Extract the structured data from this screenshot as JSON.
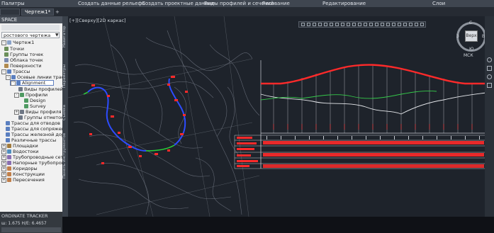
{
  "ribbon": {
    "items": [
      {
        "label": "Палитры"
      },
      {
        "label": "Создать данные рельефа"
      },
      {
        "label": "Создать проектные данные"
      },
      {
        "label": "Виды профилей и сечений"
      },
      {
        "label": "Рисование"
      },
      {
        "label": "Редактирование"
      },
      {
        "label": "Слои"
      }
    ]
  },
  "tabs": [
    {
      "label": "Чертеж1*"
    }
  ],
  "palette": {
    "title": "SPACE",
    "drop_value": "ростового чертежа",
    "tree": [
      {
        "label": "Чертеж1",
        "level": 0
      },
      {
        "label": "Точки",
        "level": 1
      },
      {
        "label": "Группы точек",
        "level": 1
      },
      {
        "label": "Облака точек",
        "level": 1
      },
      {
        "label": "Поверхности",
        "level": 1
      },
      {
        "label": "Трассы",
        "level": 1
      },
      {
        "label": "Осевые линии трасс",
        "level": 2
      },
      {
        "label": "Alignment",
        "level": 3
      },
      {
        "label": "Виды профилей",
        "level": 4
      },
      {
        "label": "Профили",
        "level": 4
      },
      {
        "label": "Design",
        "level": 5
      },
      {
        "label": "Survey",
        "level": 5
      },
      {
        "label": "Виды профиля",
        "level": 4
      },
      {
        "label": "Группы отметок",
        "level": 4
      },
      {
        "label": "Трассы для отводов",
        "level": 2
      },
      {
        "label": "Трассы для сопряжения",
        "level": 2
      },
      {
        "label": "Трассы железной дороги",
        "level": 2
      },
      {
        "label": "Различные трассы",
        "level": 2
      },
      {
        "label": "Площадки",
        "level": 1
      },
      {
        "label": "Водостоки",
        "level": 1
      },
      {
        "label": "Трубопроводные сети",
        "level": 1
      },
      {
        "label": "Напорные трубопроводные с...",
        "level": 1
      },
      {
        "label": "Коридоры",
        "level": 1
      },
      {
        "label": "Конструкции",
        "level": 1
      },
      {
        "label": "Пересечения",
        "level": 1
      }
    ],
    "side_tabs": [
      "Навигатор",
      "Параметры",
      "Съемка",
      "Панель инструментов"
    ],
    "coord": {
      "title": "ORDINATE TRACKER",
      "line": "ш: 1.675    Н/Е: 6.4657"
    }
  },
  "viewport": {
    "label": "[+][Сверху][2D каркас]",
    "viewcube": {
      "face": "Верх",
      "north": "С",
      "south": "Ю",
      "west": "З",
      "east": "В"
    },
    "wcs": "МСК"
  },
  "colors": {
    "profile_red": "#ff2a2a",
    "alignment_blue": "#2d4cff",
    "alignment_green": "#2bd13a",
    "survey_green": "#35c94a"
  }
}
